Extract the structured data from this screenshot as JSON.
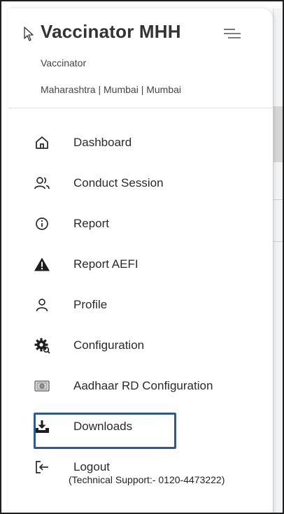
{
  "header": {
    "title": "Vaccinator MHH",
    "role": "Vaccinator",
    "location": "Maharashtra | Mumbai | Mumbai"
  },
  "nav": {
    "items": [
      {
        "label": "Dashboard",
        "icon": "home-icon"
      },
      {
        "label": "Conduct Session",
        "icon": "users-icon"
      },
      {
        "label": "Report",
        "icon": "info-icon"
      },
      {
        "label": "Report AEFI",
        "icon": "warning-icon"
      },
      {
        "label": "Profile",
        "icon": "user-icon"
      },
      {
        "label": "Configuration",
        "icon": "settings-gear-icon"
      },
      {
        "label": "Aadhaar RD Configuration",
        "icon": "fingerprint-device-icon"
      },
      {
        "label": "Downloads",
        "icon": "download-tray-icon"
      },
      {
        "label": "Logout",
        "icon": "logout-icon"
      }
    ],
    "highlighted": "Downloads"
  },
  "footer": {
    "support": "(Technical Support:- 0120-4473222)"
  },
  "colors": {
    "highlight_border": "#2e5b8f",
    "text": "#2a2a2a"
  }
}
